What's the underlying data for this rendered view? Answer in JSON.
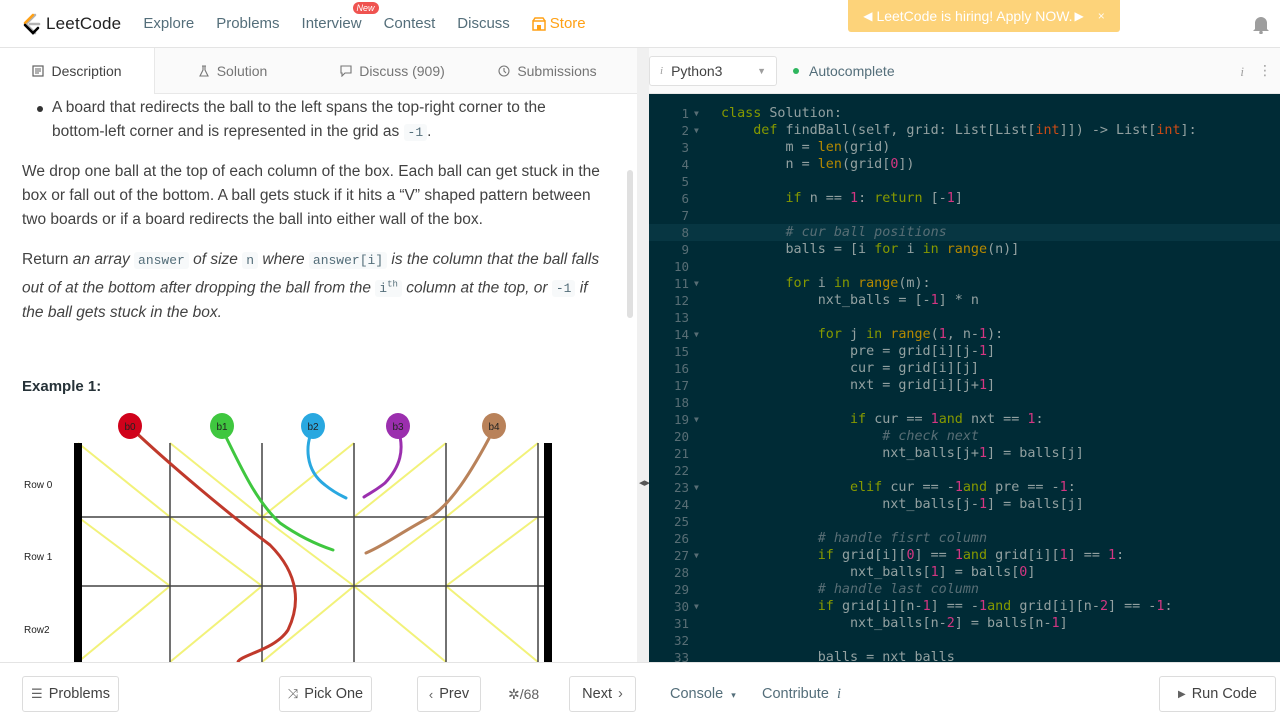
{
  "nav": {
    "brand": "LeetCode",
    "items": [
      "Explore",
      "Problems",
      "Interview",
      "Contest",
      "Discuss"
    ],
    "new_badge": "New",
    "store": "Store",
    "hiring_banner": "LeetCode is hiring! Apply NOW.",
    "hiring_close": "×",
    "colors": {
      "brand_orange": "#ffa116",
      "banner": "#fdd37a"
    }
  },
  "left_tabs": {
    "description": "Description",
    "solution": "Solution",
    "discuss": "Discuss (909)",
    "submissions": "Submissions"
  },
  "description": {
    "bullet_line1": "A board that redirects the ball to the left spans the top-right corner to the",
    "bullet_line2": "bottom-left corner and is represented in the grid as",
    "bullet_code": "-1",
    "bullet_end": ".",
    "para1": "We drop one ball at the top of each column of the box. Each ball can get stuck in the box or fall out of the bottom. A ball gets stuck if it hits a “V” shaped pattern between two boards or if a board redirects the ball into either wall of the box.",
    "para2_a": "Return ",
    "para2_b": "an array ",
    "para2_code1": "answer",
    "para2_c": " of size ",
    "para2_code2": "n",
    "para2_d": " where ",
    "para2_code3": "answer[i]",
    "para2_e": " is the column that the ball falls out of at the bottom after dropping the ball from the ",
    "para2_code4": "i",
    "para2_sup": "th",
    "para2_f": " column at the top, or ",
    "para2_code5": "-1",
    "para2_g": " if the ball gets stuck in the box.",
    "example_heading": "Example 1:"
  },
  "diagram": {
    "balls": [
      {
        "label": "b0",
        "color": "#d0021b"
      },
      {
        "label": "b1",
        "color": "#3fc73f"
      },
      {
        "label": "b2",
        "color": "#29a8e0"
      },
      {
        "label": "b3",
        "color": "#9b2fae"
      },
      {
        "label": "b4",
        "color": "#b9825a"
      }
    ],
    "rows": [
      "Row 0",
      "Row 1",
      "Row2"
    ],
    "board_color": "#f2f27a",
    "grid": [
      [
        1,
        1,
        -1,
        -1,
        -1
      ],
      [
        1,
        1,
        1,
        -1,
        -1
      ],
      [
        -1,
        -1,
        -1,
        1,
        1
      ]
    ]
  },
  "editor": {
    "language": "Python3",
    "autocomplete": "Autocomplete",
    "info_icon": "i",
    "more_icon": "⋮",
    "highlight_line": 8,
    "lines": [
      [
        [
          "kw",
          "class"
        ],
        [
          "",
          "Solution:"
        ]
      ],
      [
        [
          "",
          "    "
        ],
        [
          "kw",
          "def"
        ],
        [
          "",
          "findBall(self, grid: List[List["
        ],
        [
          "ty",
          "int"
        ],
        [
          "",
          "]]) -> List["
        ],
        [
          "ty",
          "int"
        ],
        [
          "",
          "]:"
        ]
      ],
      [
        [
          "",
          "        m = "
        ],
        [
          "bi",
          "len"
        ],
        [
          "",
          "(grid)"
        ]
      ],
      [
        [
          "",
          "        n = "
        ],
        [
          "bi",
          "len"
        ],
        [
          "",
          "(grid["
        ],
        [
          "num",
          "0"
        ],
        [
          "",
          "])"
        ]
      ],
      [
        [
          "",
          ""
        ]
      ],
      [
        [
          "",
          "        "
        ],
        [
          "kw",
          "if"
        ],
        [
          "",
          "n == "
        ],
        [
          "num",
          "1"
        ],
        [
          "",
          ": "
        ],
        [
          "kw",
          "return"
        ],
        [
          "",
          ""
        ],
        [
          "",
          "[-"
        ],
        [
          "num",
          "1"
        ],
        [
          "",
          "]"
        ]
      ],
      [
        [
          "",
          ""
        ]
      ],
      [
        [
          "",
          "        "
        ],
        [
          "cm",
          "# cur ball positions"
        ]
      ],
      [
        [
          "",
          "        balls = [i "
        ],
        [
          "kw",
          "for"
        ],
        [
          "",
          "i "
        ],
        [
          "kw",
          "in"
        ],
        [
          "",
          ""
        ],
        [
          "bi",
          "range"
        ],
        [
          "",
          "(n)]"
        ]
      ],
      [
        [
          "",
          ""
        ]
      ],
      [
        [
          "",
          "        "
        ],
        [
          "kw",
          "for"
        ],
        [
          "",
          "i "
        ],
        [
          "kw",
          "in"
        ],
        [
          "",
          ""
        ],
        [
          "bi",
          "range"
        ],
        [
          "",
          "(m):"
        ]
      ],
      [
        [
          "",
          "            nxt_balls = [-"
        ],
        [
          "num",
          "1"
        ],
        [
          "",
          "] * n"
        ]
      ],
      [
        [
          "",
          ""
        ]
      ],
      [
        [
          "",
          "            "
        ],
        [
          "kw",
          "for"
        ],
        [
          "",
          "j "
        ],
        [
          "kw",
          "in"
        ],
        [
          "",
          ""
        ],
        [
          "bi",
          "range"
        ],
        [
          "",
          "("
        ],
        [
          "num",
          "1"
        ],
        [
          "",
          ", n-"
        ],
        [
          "num",
          "1"
        ],
        [
          "",
          "):"
        ]
      ],
      [
        [
          "",
          "                pre = grid[i][j-"
        ],
        [
          "num",
          "1"
        ],
        [
          "",
          "]"
        ]
      ],
      [
        [
          "",
          "                cur = grid[i][j]"
        ]
      ],
      [
        [
          "",
          "                nxt = grid[i][j+"
        ],
        [
          "num",
          "1"
        ],
        [
          "",
          "]"
        ]
      ],
      [
        [
          "",
          ""
        ]
      ],
      [
        [
          "",
          "                "
        ],
        [
          "kw",
          "if"
        ],
        [
          "",
          "cur == "
        ],
        [
          "num",
          "1"
        ],
        [
          "",
          ""
        ],
        [
          "kw",
          "and"
        ],
        [
          "",
          "nxt == "
        ],
        [
          "num",
          "1"
        ],
        [
          "",
          ":"
        ]
      ],
      [
        [
          "",
          "                    "
        ],
        [
          "cm",
          "# check next"
        ]
      ],
      [
        [
          "",
          "                    nxt_balls[j+"
        ],
        [
          "num",
          "1"
        ],
        [
          "",
          "] = balls[j]"
        ]
      ],
      [
        [
          "",
          ""
        ]
      ],
      [
        [
          "",
          "                "
        ],
        [
          "kw",
          "elif"
        ],
        [
          "",
          "cur == -"
        ],
        [
          "num",
          "1"
        ],
        [
          "",
          ""
        ],
        [
          "kw",
          "and"
        ],
        [
          "",
          "pre == -"
        ],
        [
          "num",
          "1"
        ],
        [
          "",
          ":"
        ]
      ],
      [
        [
          "",
          "                    nxt_balls[j-"
        ],
        [
          "num",
          "1"
        ],
        [
          "",
          "] = balls[j]"
        ]
      ],
      [
        [
          "",
          ""
        ]
      ],
      [
        [
          "",
          "            "
        ],
        [
          "cm",
          "# handle fisrt column"
        ]
      ],
      [
        [
          "",
          "            "
        ],
        [
          "kw",
          "if"
        ],
        [
          "",
          "grid[i]["
        ],
        [
          "num",
          "0"
        ],
        [
          "",
          "] == "
        ],
        [
          "num",
          "1"
        ],
        [
          "",
          ""
        ],
        [
          "kw",
          "and"
        ],
        [
          "",
          "grid[i]["
        ],
        [
          "num",
          "1"
        ],
        [
          "",
          "] == "
        ],
        [
          "num",
          "1"
        ],
        [
          "",
          ":"
        ]
      ],
      [
        [
          "",
          "                nxt_balls["
        ],
        [
          "num",
          "1"
        ],
        [
          "",
          "] = balls["
        ],
        [
          "num",
          "0"
        ],
        [
          "",
          "]"
        ]
      ],
      [
        [
          "",
          "            "
        ],
        [
          "cm",
          "# handle last column"
        ]
      ],
      [
        [
          "",
          "            "
        ],
        [
          "kw",
          "if"
        ],
        [
          "",
          "grid[i][n-"
        ],
        [
          "num",
          "1"
        ],
        [
          "",
          "] == -"
        ],
        [
          "num",
          "1"
        ],
        [
          "",
          ""
        ],
        [
          "kw",
          "and"
        ],
        [
          "",
          "grid[i][n-"
        ],
        [
          "num",
          "2"
        ],
        [
          "",
          "] == -"
        ],
        [
          "num",
          "1"
        ],
        [
          "",
          ":"
        ]
      ],
      [
        [
          "",
          "                nxt_balls[n-"
        ],
        [
          "num",
          "2"
        ],
        [
          "",
          "] = balls[n-"
        ],
        [
          "num",
          "1"
        ],
        [
          "",
          "]"
        ]
      ],
      [
        [
          "",
          ""
        ]
      ],
      [
        [
          "",
          "            balls = nxt_balls"
        ]
      ]
    ],
    "fold_lines": [
      1,
      2,
      11,
      14,
      19,
      23,
      27,
      30
    ]
  },
  "bottom": {
    "problems": "Problems",
    "pick_one": "Pick One",
    "prev": "Prev",
    "pager": "/68",
    "next": "Next",
    "console": "Console",
    "contribute": "Contribute",
    "run_code": "Run Code"
  }
}
